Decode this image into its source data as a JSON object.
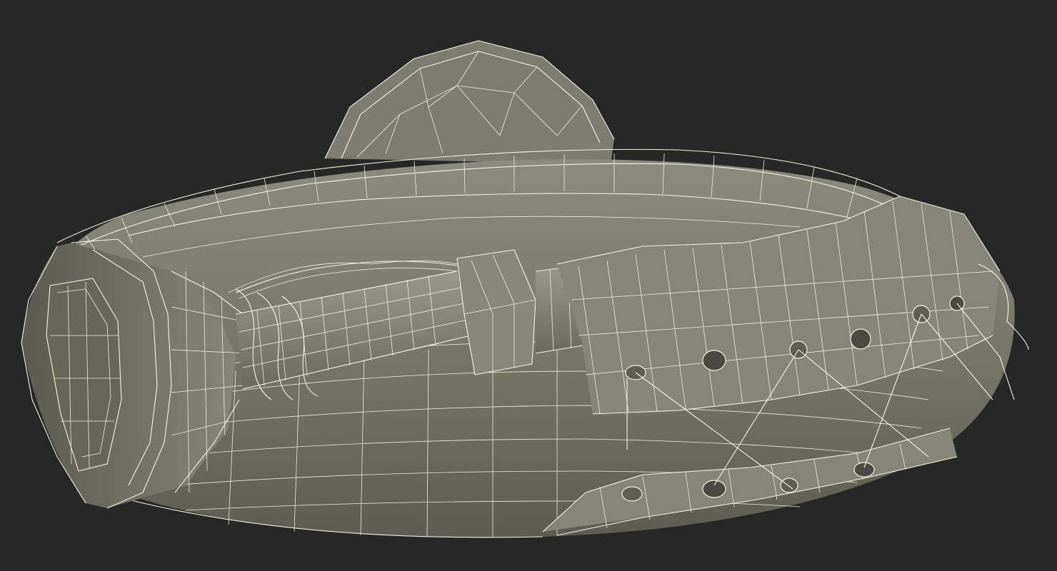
{
  "scene": {
    "background": "#272727",
    "surface_color": "#7c7c70",
    "wire_color": "#f4f2e2",
    "subject": "horn-wireframe"
  }
}
